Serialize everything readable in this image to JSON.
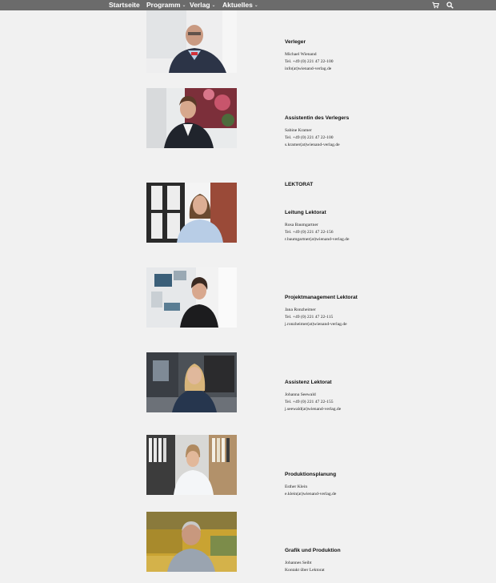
{
  "nav": {
    "items": [
      {
        "label": "Startseite",
        "dropdown": false
      },
      {
        "label": "Programm",
        "dropdown": true
      },
      {
        "label": "Verlag",
        "dropdown": true
      },
      {
        "label": "Aktuelles",
        "dropdown": true
      }
    ],
    "cart_icon": "shopping-cart-icon",
    "search_icon": "search-icon",
    "bar_color": "#6b6b6b"
  },
  "section_heading": "LEKTORAT",
  "people": [
    {
      "role": "Verleger",
      "name": "Michael Wienand",
      "phone": "Tel. +49 (0) 221 47 22-100",
      "email": "info(at)wienand-verlag.de"
    },
    {
      "role": "Assistentin des Verlegers",
      "name": "Sabine Kramer",
      "phone": "Tel. +49 (0) 221 47 22-100",
      "email": "s.kramer(at)wienand-verlag.de"
    },
    {
      "role": "Leitung Lektorat",
      "name": "Rosa Baumgartner",
      "phone": "Tel. +49 (0) 221 47 22-156",
      "email": "r.baumgartner(at)wienand-verlag.de"
    },
    {
      "role": "Projektmanagement Lektorat",
      "name": "Jana Ronzheimer",
      "phone": "Tel. +49 (0) 221 47 22-115",
      "email": "j.ronzheimer(at)wienand-verlag.de"
    },
    {
      "role": "Assistenz Lektorat",
      "name": "Johanna Seewald",
      "phone": "Tel. +49 (0) 221 47 22-155",
      "email": "j.seewald(at)wienand-verlag.de"
    },
    {
      "role": "Produktionsplanung",
      "name": "Esther Klein",
      "email": "e.klein(at)wienand-verlag.de"
    },
    {
      "role": "Grafik und Produktion",
      "name": "Johannes Seibt",
      "note": "Kontakt über Lektorat"
    }
  ]
}
